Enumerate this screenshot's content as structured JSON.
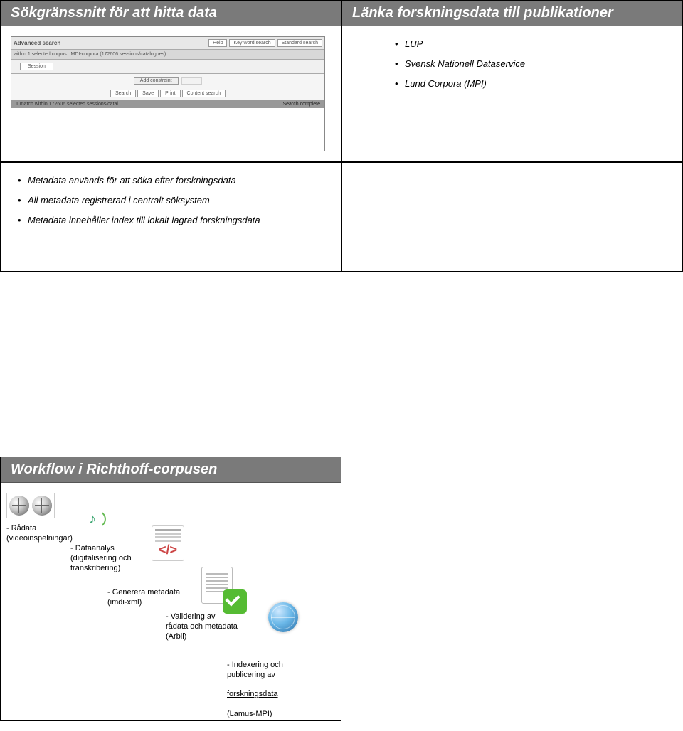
{
  "row1": {
    "left": {
      "title": "Sökgränssnitt för att hitta data",
      "mock": {
        "advanced": "Advanced search",
        "help": "Help",
        "keyword": "Key word search",
        "standard": "Standard search",
        "within_line": "within 1 selected corpus: IMDI-corpora (172606 sessions/catalogues)",
        "session": "Session",
        "add": "Add constraint",
        "search": "Search",
        "save": "Save",
        "print": "Print",
        "content": "Content search",
        "status_left": "1 match within 172606 selected sessions/catal...",
        "status_right": "Search complete"
      }
    },
    "right": {
      "title": "Länka forskningsdata till publikationer",
      "items": [
        "LUP",
        "Svensk Nationell Dataservice",
        "Lund Corpora (MPI)"
      ]
    }
  },
  "row2": {
    "left": {
      "items": [
        "Metadata används för att söka efter forskningsdata",
        "All metadata registrerad i centralt söksystem",
        "Metadata innehåller index till lokalt lagrad forskningsdata"
      ]
    }
  },
  "row3": {
    "title": "Workflow i Richthoff-corpusen",
    "steps": {
      "s1": "- Rådata\n(videoinspelningar)",
      "s2": "- Dataanalys\n(digitalisering och\ntranskribering)",
      "s3": "- Generera metadata\n(imdi-xml)",
      "s4": "- Validering av\nrådata och metadata\n(Arbil)",
      "s5": "- Indexering och\npublicering av",
      "s5b": "forskningsdata",
      "s5c": "(Lamus-MPI)"
    }
  }
}
